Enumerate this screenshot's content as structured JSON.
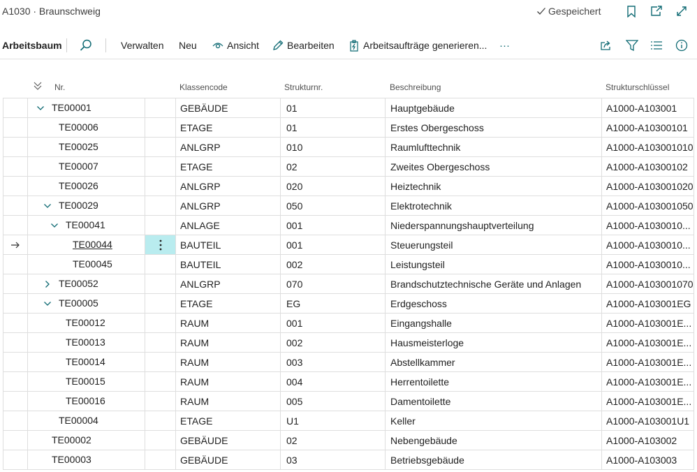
{
  "window": {
    "title": "A1030 · Braunschweig",
    "saved_label": "Gespeichert"
  },
  "actions": {
    "tree_label": "Arbeitsbaum",
    "manage": "Verwalten",
    "new": "Neu",
    "view": "Ansicht",
    "edit": "Bearbeiten",
    "generate": "Arbeitsaufträge generieren...",
    "more": "···"
  },
  "columns": {
    "nr": "Nr.",
    "class_code": "Klassencode",
    "struct_nr": "Strukturnr.",
    "description": "Beschreibung",
    "struct_key": "Strukturschlüssel"
  },
  "rows": [
    {
      "nr": "TE00001",
      "class_code": "GEBÄUDE",
      "struct_nr": "01",
      "description": "Hauptgebäude",
      "struct_key": "A1000-A103001",
      "level": 0,
      "expander": "expanded",
      "selected": false
    },
    {
      "nr": "TE00006",
      "class_code": "ETAGE",
      "struct_nr": "01",
      "description": "Erstes Obergeschoss",
      "struct_key": "A1000-A10300101",
      "level": 1,
      "expander": "none",
      "selected": false
    },
    {
      "nr": "TE00025",
      "class_code": "ANLGRP",
      "struct_nr": "010",
      "description": "Raumlufttechnik",
      "struct_key": "A1000-A103001010",
      "level": 1,
      "expander": "none",
      "selected": false
    },
    {
      "nr": "TE00007",
      "class_code": "ETAGE",
      "struct_nr": "02",
      "description": "Zweites Obergeschoss",
      "struct_key": "A1000-A10300102",
      "level": 1,
      "expander": "none",
      "selected": false
    },
    {
      "nr": "TE00026",
      "class_code": "ANLGRP",
      "struct_nr": "020",
      "description": "Heiztechnik",
      "struct_key": "A1000-A103001020",
      "level": 1,
      "expander": "none",
      "selected": false
    },
    {
      "nr": "TE00029",
      "class_code": "ANLGRP",
      "struct_nr": "050",
      "description": "Elektrotechnik",
      "struct_key": "A1000-A103001050",
      "level": 1,
      "expander": "expanded",
      "selected": false
    },
    {
      "nr": "TE00041",
      "class_code": "ANLAGE",
      "struct_nr": "001",
      "description": "Niederspannungshauptverteilung",
      "struct_key": "A1000-A1030010...",
      "level": 2,
      "expander": "expanded",
      "selected": false
    },
    {
      "nr": "TE00044",
      "class_code": "BAUTEIL",
      "struct_nr": "001",
      "description": "Steuerungsteil",
      "struct_key": "A1000-A1030010...",
      "level": 3,
      "expander": "none",
      "selected": true
    },
    {
      "nr": "TE00045",
      "class_code": "BAUTEIL",
      "struct_nr": "002",
      "description": "Leistungsteil",
      "struct_key": "A1000-A1030010...",
      "level": 3,
      "expander": "none",
      "selected": false
    },
    {
      "nr": "TE00052",
      "class_code": "ANLGRP",
      "struct_nr": "070",
      "description": "Brandschutztechnische Geräte und Anlagen",
      "struct_key": "A1000-A103001070",
      "level": 1,
      "expander": "collapsed",
      "selected": false
    },
    {
      "nr": "TE00005",
      "class_code": "ETAGE",
      "struct_nr": "EG",
      "description": "Erdgeschoss",
      "struct_key": "A1000-A103001EG",
      "level": 1,
      "expander": "expanded",
      "selected": false
    },
    {
      "nr": "TE00012",
      "class_code": "RAUM",
      "struct_nr": "001",
      "description": "Eingangshalle",
      "struct_key": "A1000-A103001E...",
      "level": 2,
      "expander": "none",
      "selected": false
    },
    {
      "nr": "TE00013",
      "class_code": "RAUM",
      "struct_nr": "002",
      "description": "Hausmeisterloge",
      "struct_key": "A1000-A103001E...",
      "level": 2,
      "expander": "none",
      "selected": false
    },
    {
      "nr": "TE00014",
      "class_code": "RAUM",
      "struct_nr": "003",
      "description": "Abstellkammer",
      "struct_key": "A1000-A103001E...",
      "level": 2,
      "expander": "none",
      "selected": false
    },
    {
      "nr": "TE00015",
      "class_code": "RAUM",
      "struct_nr": "004",
      "description": "Herrentoilette",
      "struct_key": "A1000-A103001E...",
      "level": 2,
      "expander": "none",
      "selected": false
    },
    {
      "nr": "TE00016",
      "class_code": "RAUM",
      "struct_nr": "005",
      "description": "Damentoilette",
      "struct_key": "A1000-A103001E...",
      "level": 2,
      "expander": "none",
      "selected": false
    },
    {
      "nr": "TE00004",
      "class_code": "ETAGE",
      "struct_nr": "U1",
      "description": "Keller",
      "struct_key": "A1000-A103001U1",
      "level": 1,
      "expander": "none",
      "selected": false
    },
    {
      "nr": "TE00002",
      "class_code": "GEBÄUDE",
      "struct_nr": "02",
      "description": "Nebengebäude",
      "struct_key": "A1000-A103002",
      "level": 0,
      "expander": "none",
      "selected": false
    },
    {
      "nr": "TE00003",
      "class_code": "GEBÄUDE",
      "struct_nr": "03",
      "description": "Betriebsgebäude",
      "struct_key": "A1000-A103003",
      "level": 0,
      "expander": "none",
      "selected": false
    }
  ],
  "icons": {
    "saved": "check-icon",
    "bookmark": "bookmark-icon",
    "popout": "open-in-new-window-icon",
    "expand": "expand-icon",
    "search": "search-icon",
    "view": "eye-icon",
    "edit": "pencil-icon",
    "generate": "work-order-icon",
    "share": "share-icon",
    "filter": "filter-icon",
    "list": "list-icon",
    "info": "info-icon",
    "collapse_all": "collapse-all-icon",
    "row_marker": "arrow-right-icon",
    "row_menu": "more-vertical-icon"
  },
  "colors": {
    "accent": "#0f6a73",
    "selected_cell": "#b9ecef",
    "grid_line": "#dedede"
  }
}
